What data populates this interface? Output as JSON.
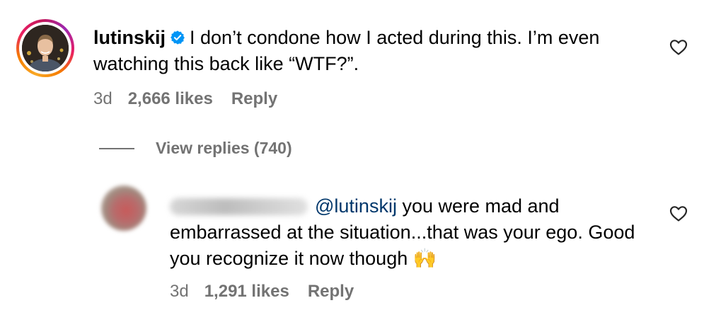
{
  "top_comment": {
    "username": "lutinskij",
    "text": "I don’t condone how I acted during this. I’m even watching this back like “WTF?”.",
    "age": "3d",
    "likes": "2,666 likes",
    "reply_label": "Reply"
  },
  "view_replies": {
    "label": "View replies (740)"
  },
  "reply_comment": {
    "mention": "@lutinskij",
    "text": " you were mad and embarrassed at the situation...that was your ego. Good you recognize it now though 🙌",
    "age": "3d",
    "likes": "1,291 likes",
    "reply_label": "Reply"
  },
  "colors": {
    "muted": "#737373",
    "mention": "#00376b",
    "verified": "#0095f6"
  }
}
